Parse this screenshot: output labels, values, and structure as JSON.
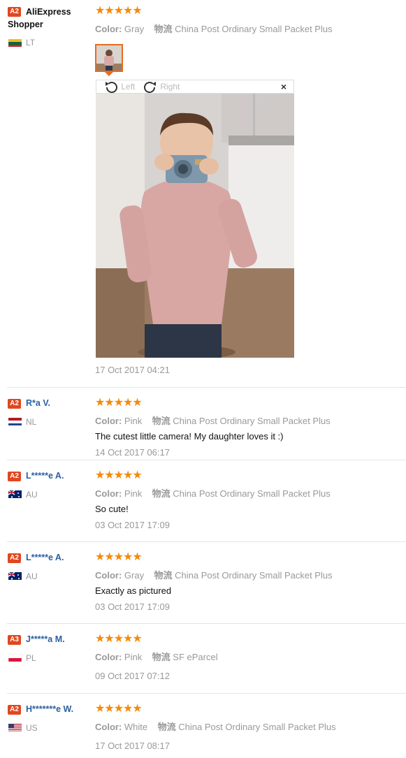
{
  "labels": {
    "color": "Color:",
    "logistics_glyph": "物流"
  },
  "viewer": {
    "left_label": "Left",
    "right_label": "Right",
    "close": "×"
  },
  "star_string": "★★★★★",
  "reviews": [
    {
      "level": "A2",
      "name_line1": "AliExpress",
      "name_line2": "Shopper",
      "country": "LT",
      "color": "Gray",
      "shipping": "China Post Ordinary Small Packet Plus",
      "date": "17 Oct 2017 04:21"
    },
    {
      "level": "A2",
      "name": "R*a V.",
      "country": "NL",
      "color": "Pink",
      "shipping": "China Post Ordinary Small Packet Plus",
      "feedback": "The cutest little camera! My daughter loves it :)",
      "date": "14 Oct 2017 06:17"
    },
    {
      "level": "A2",
      "name": "L*****e A.",
      "country": "AU",
      "color": "Pink",
      "shipping": "China Post Ordinary Small Packet Plus",
      "feedback": "So cute!",
      "date": "03 Oct 2017 17:09"
    },
    {
      "level": "A2",
      "name": "L*****e A.",
      "country": "AU",
      "color": "Gray",
      "shipping": "China Post Ordinary Small Packet Plus",
      "feedback": "Exactly as pictured",
      "date": "03 Oct 2017 17:09"
    },
    {
      "level": "A3",
      "name": "J*****a M.",
      "country": "PL",
      "color": "Pink",
      "shipping": "SF eParcel",
      "date": "09 Oct 2017 07:12"
    },
    {
      "level": "A2",
      "name": "H*******e W.",
      "country": "US",
      "color": "White",
      "shipping": "China Post Ordinary Small Packet Plus",
      "date": "17 Oct 2017 08:17"
    }
  ],
  "colors": {
    "star": "#f58a0a",
    "level_badge": "#e0471f",
    "username": "#2c5fa0",
    "muted_text": "#999999",
    "thumb_border": "#e86b1e"
  },
  "icons": [
    "rotate-left-icon",
    "rotate-right-icon",
    "close-icon",
    "flag-lt-icon",
    "flag-nl-icon",
    "flag-au-icon",
    "flag-pl-icon",
    "flag-us-icon"
  ]
}
